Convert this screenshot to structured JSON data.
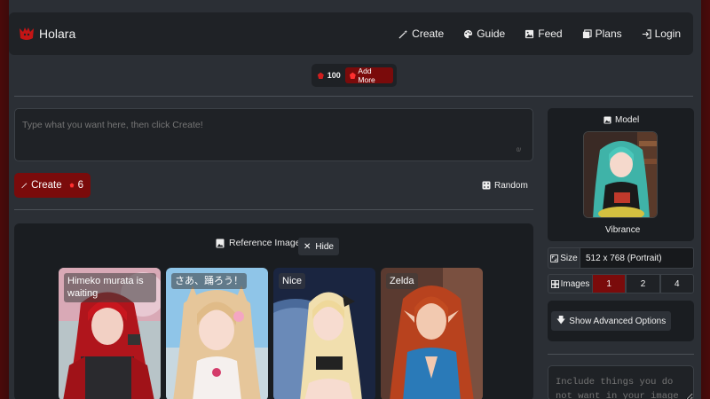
{
  "navbar": {
    "brand": "Holara",
    "links": [
      {
        "label": "Create",
        "icon": "wand-icon"
      },
      {
        "label": "Guide",
        "icon": "palette-icon"
      },
      {
        "label": "Feed",
        "icon": "image-icon"
      },
      {
        "label": "Plans",
        "icon": "layers-icon"
      },
      {
        "label": "Login",
        "icon": "login-icon"
      }
    ]
  },
  "credits": {
    "count": "100",
    "add_more_label": "Add More"
  },
  "prompt": {
    "placeholder": "Type what you want here, then click Create!",
    "counter": "0/"
  },
  "create_button": {
    "label": "Create",
    "cost": "6"
  },
  "random_button": {
    "label": "Random"
  },
  "reference": {
    "title": "Reference Images",
    "hide_label": "Hide",
    "cards": [
      {
        "label": "Himeko murata is waiting"
      },
      {
        "label": "さあ、踊ろう！"
      },
      {
        "label": "Nice"
      },
      {
        "label": "Zelda"
      }
    ]
  },
  "model": {
    "title": "Model",
    "name": "Vibrance"
  },
  "size": {
    "label": "Size",
    "value": "512 x 768 (Portrait)"
  },
  "images": {
    "label": "Images",
    "options": [
      "1",
      "2",
      "4"
    ],
    "selected": "1"
  },
  "advanced": {
    "label": "Show Advanced Options"
  },
  "negative_prompt": {
    "placeholder": "Include things you do not want in your image here"
  },
  "colors": {
    "accent": "#7a0b0b",
    "background": "#2b2f35",
    "panel": "#1a1d21"
  }
}
